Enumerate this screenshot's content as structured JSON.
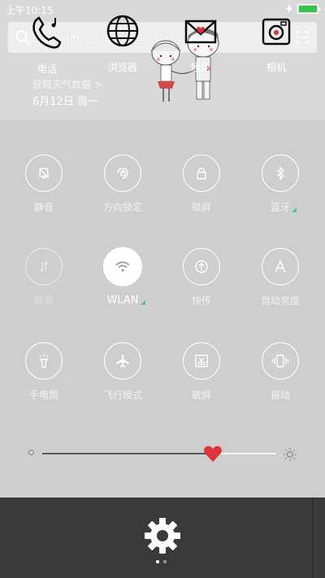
{
  "status": {
    "time": "上午10:15",
    "battery_level": 1.0,
    "battery_color": "#34c44a"
  },
  "search": {
    "placeholder": "搜索网页、设置、应用、视频"
  },
  "weather": {
    "link": "获取天气数据 >",
    "date": "6月12日 周一"
  },
  "toggles": [
    {
      "label": "静音",
      "icon": "bell-off-icon",
      "state": "off"
    },
    {
      "label": "方向锁定",
      "icon": "rotation-lock-icon",
      "state": "off"
    },
    {
      "label": "锁屏",
      "icon": "lock-icon",
      "state": "off"
    },
    {
      "label": "蓝牙",
      "icon": "bluetooth-icon",
      "state": "off",
      "has_more": true
    },
    {
      "label": "数据",
      "icon": "mobile-data-icon",
      "state": "disabled"
    },
    {
      "label": "WLAN",
      "icon": "wifi-icon",
      "state": "on",
      "has_more": true
    },
    {
      "label": "快传",
      "icon": "quick-transfer-icon",
      "state": "off"
    },
    {
      "label": "自动亮度",
      "icon": "auto-brightness-icon",
      "state": "off"
    },
    {
      "label": "手电筒",
      "icon": "flashlight-icon",
      "state": "off"
    },
    {
      "label": "飞行模式",
      "icon": "airplane-icon",
      "state": "off"
    },
    {
      "label": "截屏",
      "icon": "screenshot-icon",
      "state": "off"
    },
    {
      "label": "振动",
      "icon": "vibrate-icon",
      "state": "off"
    }
  ],
  "brightness": {
    "level": 0.73,
    "thumb_color": "#e0343c"
  },
  "dock": [
    {
      "label": "电话",
      "icon": "phone-icon"
    },
    {
      "label": "浏览器",
      "icon": "browser-globe-icon"
    },
    {
      "label": "短信",
      "icon": "messages-icon"
    },
    {
      "label": "相机",
      "icon": "camera-icon"
    }
  ],
  "page_indicator": {
    "count": 2,
    "current": 1
  }
}
